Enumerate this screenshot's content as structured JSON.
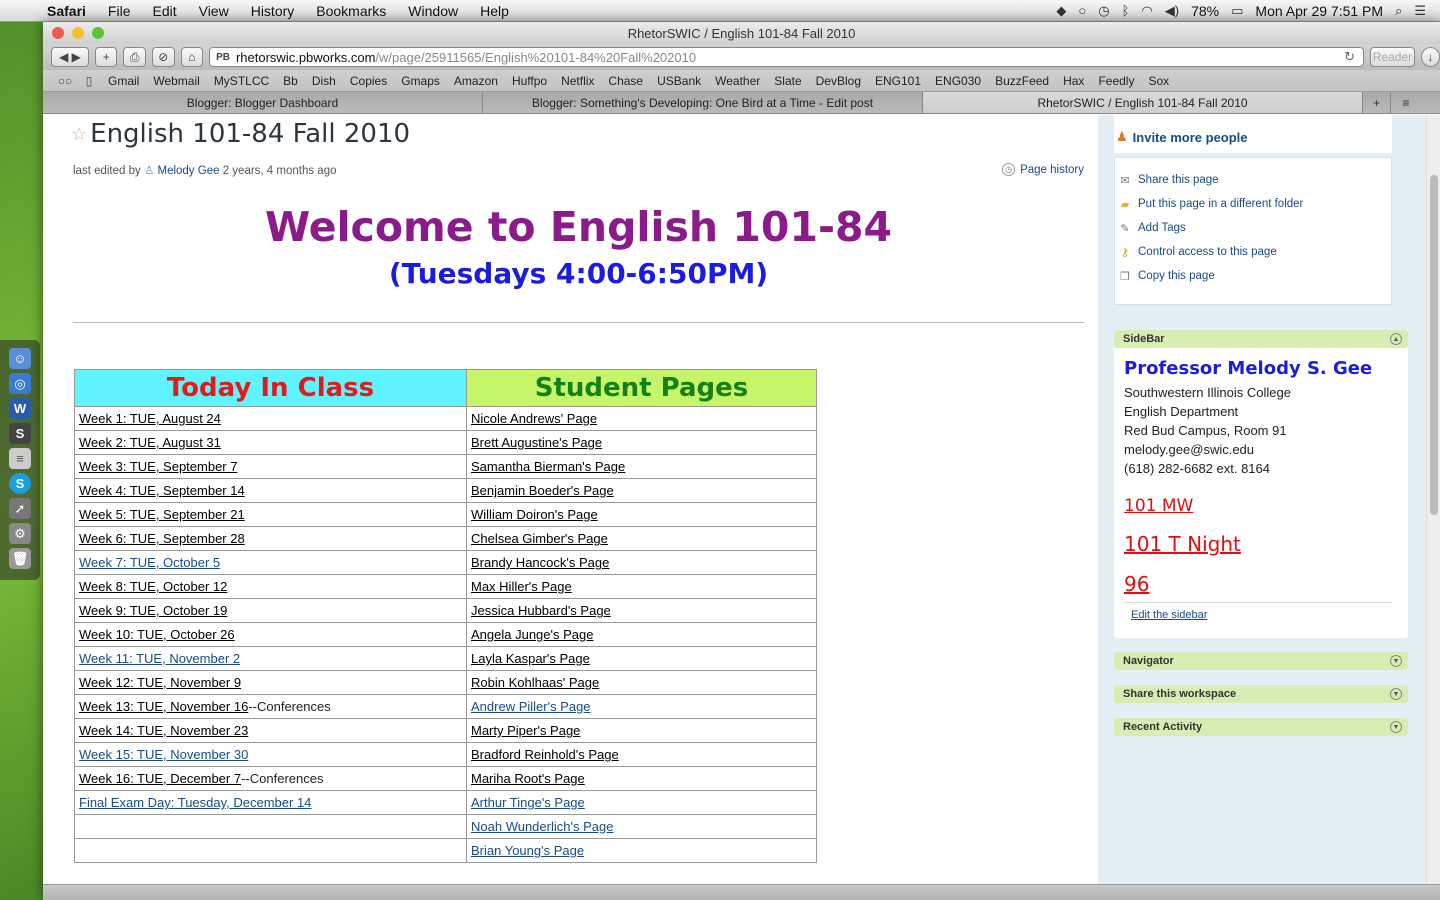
{
  "menubar": {
    "app": "Safari",
    "items": [
      "File",
      "Edit",
      "View",
      "History",
      "Bookmarks",
      "Window",
      "Help"
    ],
    "battery": "78%",
    "clock": "Mon Apr 29  7:51 PM"
  },
  "window": {
    "title": "RhetorSWIC / English 101-84 Fall 2010",
    "address_host": "rhetorswic.pbworks.com",
    "address_path": "/w/page/25911565/English%20101-84%20Fall%202010",
    "favicon_text": "PB",
    "reader_label": "Reader"
  },
  "bookmarks": [
    "Gmail",
    "Webmail",
    "MySTLCC",
    "Bb",
    "Dish",
    "Copies",
    "Gmaps",
    "Amazon",
    "Huffpo",
    "Netflix",
    "Chase",
    "USBank",
    "Weather",
    "Slate",
    "DevBlog",
    "ENG101",
    "ENG030",
    "BuzzFeed",
    "Hax",
    "Feedly",
    "Sox"
  ],
  "tabs": [
    "Blogger: Blogger Dashboard",
    "Blogger: Something's Developing: One Bird at a Time - Edit post",
    "RhetorSWIC / English 101-84 Fall 2010"
  ],
  "page": {
    "title": "English 101-84 Fall 2010",
    "edited_prefix": "last edited by",
    "editor": "Melody Gee",
    "edited_ago": "2 years, 4 months ago",
    "history_label": "Page history",
    "welcome": "Welcome to English 101-84",
    "schedule": "(Tuesdays 4:00-6:50PM)"
  },
  "table": {
    "header_left": "Today In Class",
    "header_right": "Student Pages",
    "rows": [
      {
        "week": "Week 1:  TUE, August 24",
        "suffix": "",
        "student": "Nicole Andrews' Page"
      },
      {
        "week": "Week 2:  TUE, August 31",
        "suffix": "",
        "student": "Brett Augustine's Page"
      },
      {
        "week": "Week 3:  TUE, September 7",
        "suffix": "",
        "student": "Samantha Bierman's Page"
      },
      {
        "week": "Week 4:  TUE, September 14",
        "suffix": "",
        "student": "Benjamin Boeder's Page"
      },
      {
        "week": "Week 5:  TUE, September 21",
        "suffix": "",
        "student": "William Doiron's Page"
      },
      {
        "week": "Week 6:  TUE, September 28",
        "suffix": "",
        "student": "Chelsea Gimber's Page"
      },
      {
        "week": "Week 7:  TUE, October 5",
        "suffix": "",
        "student": "Brandy Hancock's Page"
      },
      {
        "week": "Week 8:  TUE, October 12",
        "suffix": "",
        "student": "Max Hiller's Page"
      },
      {
        "week": "Week 9:  TUE, October 19",
        "suffix": "",
        "student": "Jessica Hubbard's Page"
      },
      {
        "week": "Week 10:  TUE, October 26",
        "suffix": "",
        "student": "Angela Junge's Page"
      },
      {
        "week": "Week 11:  TUE, November 2",
        "suffix": "",
        "student": "Layla Kaspar's Page"
      },
      {
        "week": "Week 12:  TUE, November 9",
        "suffix": "",
        "student": "Robin Kohlhaas' Page"
      },
      {
        "week": "Week 13:  TUE, November 16",
        "suffix": "--Conferences",
        "student": "Andrew Piller's Page"
      },
      {
        "week": "Week 14:  TUE, November 23",
        "suffix": "",
        "student": "Marty Piper's Page"
      },
      {
        "week": "Week 15:  TUE, November 30",
        "suffix": "",
        "student": "Bradford Reinhold's Page"
      },
      {
        "week": "Week 16:  TUE, December 7",
        "suffix": "--Conferences",
        "student": "Mariha Root's Page"
      },
      {
        "week": "Final Exam Day: Tuesday, December 14",
        "suffix": "",
        "student": "Arthur Tinge's Page"
      },
      {
        "week": "",
        "suffix": "",
        "student": "Noah Wunderlich's Page"
      },
      {
        "week": "",
        "suffix": "",
        "student": "Brian Young's Page"
      }
    ]
  },
  "sidebar": {
    "invite": "Invite more people",
    "actions": [
      "Share this page",
      "Put this page in a different folder",
      "Add Tags",
      "Control access to this page",
      "Copy this page"
    ],
    "panel_title": "SideBar",
    "prof_name": "Professor Melody S. Gee",
    "lines": [
      "Southwestern Illinois College",
      "English Department",
      "Red Bud Campus, Room 91",
      "melody.gee@swic.edu",
      "(618) 282-6682 ext. 8164"
    ],
    "link1": "101 MW",
    "link2": "101 T Night",
    "link3": "96",
    "edit_sidebar": "Edit the sidebar",
    "navigator": "Navigator",
    "share_workspace": "Share this workspace",
    "recent_activity": "Recent Activity"
  },
  "colors": {
    "welcome": "#8b1a8b",
    "schedule": "#1c1ce0",
    "header_left_bg": "#5ff2ff",
    "header_left_text": "#e41a1a",
    "header_right_bg": "#c6f56a",
    "header_right_text": "#158015",
    "sidebar_links": "#e01010"
  }
}
